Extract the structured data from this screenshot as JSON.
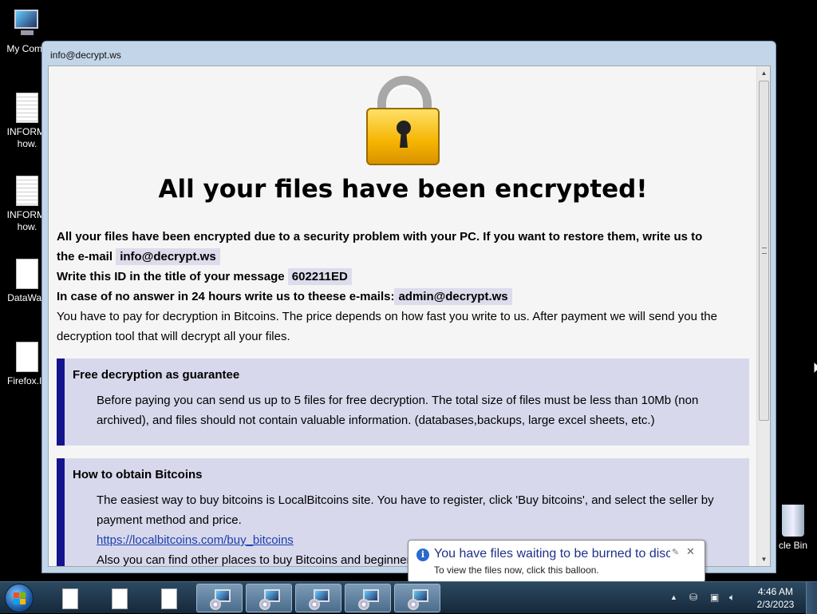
{
  "desktop": {
    "icons": [
      {
        "label": "My Comp",
        "kind": "computer"
      },
      {
        "label": "INFORM/\nhow.",
        "kind": "text-file"
      },
      {
        "label": "INFORM/\nhow.",
        "kind": "text-file"
      },
      {
        "label": "DataWag",
        "kind": "file"
      },
      {
        "label": "Firefox.In",
        "kind": "file"
      }
    ],
    "recycle_bin_label": "cle Bin"
  },
  "window": {
    "title": "info@decrypt.ws",
    "headline": "All your files have been encrypted!",
    "line1": "All your files have been encrypted due to a security problem with your PC. If you want to restore them, write us to",
    "line1b": "the e-mail",
    "email": "info@decrypt.ws",
    "id_label": "Write this ID in the title of your message",
    "id_value": "602211ED",
    "noanswer_label": "In case of no answer in 24 hours write us to theese e-mails:",
    "alt_email": "admin@decrypt.ws",
    "payment_text": "You have to pay for decryption in Bitcoins. The price depends on how fast you write to us. After payment we will send you the decryption tool that will decrypt all your files.",
    "box1": {
      "title": "Free decryption as guarantee",
      "text": "Before paying you can send us up to 5 files for free decryption. The total size of files must be less than 10Mb (non archived), and files should not contain valuable information. (databases,backups, large excel sheets, etc.)"
    },
    "box2": {
      "title": "How to obtain Bitcoins",
      "text": "The easiest way to buy bitcoins is LocalBitcoins site. You have to register, click 'Buy bitcoins', and select the seller by payment method and price.",
      "link": "https://localbitcoins.com/buy_bitcoins",
      "text2": "Also you can find other places to buy Bitcoins and beginners guide here:"
    }
  },
  "balloon": {
    "title": "You have files waiting to be burned to disc",
    "body": "To view the files now, click this balloon.",
    "close": "✕"
  },
  "taskbar": {
    "time": "4:46 AM",
    "date": "2/3/2023",
    "tray_arrow": "▲"
  },
  "colors": {
    "box_border": "#14148c",
    "box_bg": "#d8d8ec",
    "balloon_title": "#1e3287",
    "link": "#1a3fb0"
  }
}
